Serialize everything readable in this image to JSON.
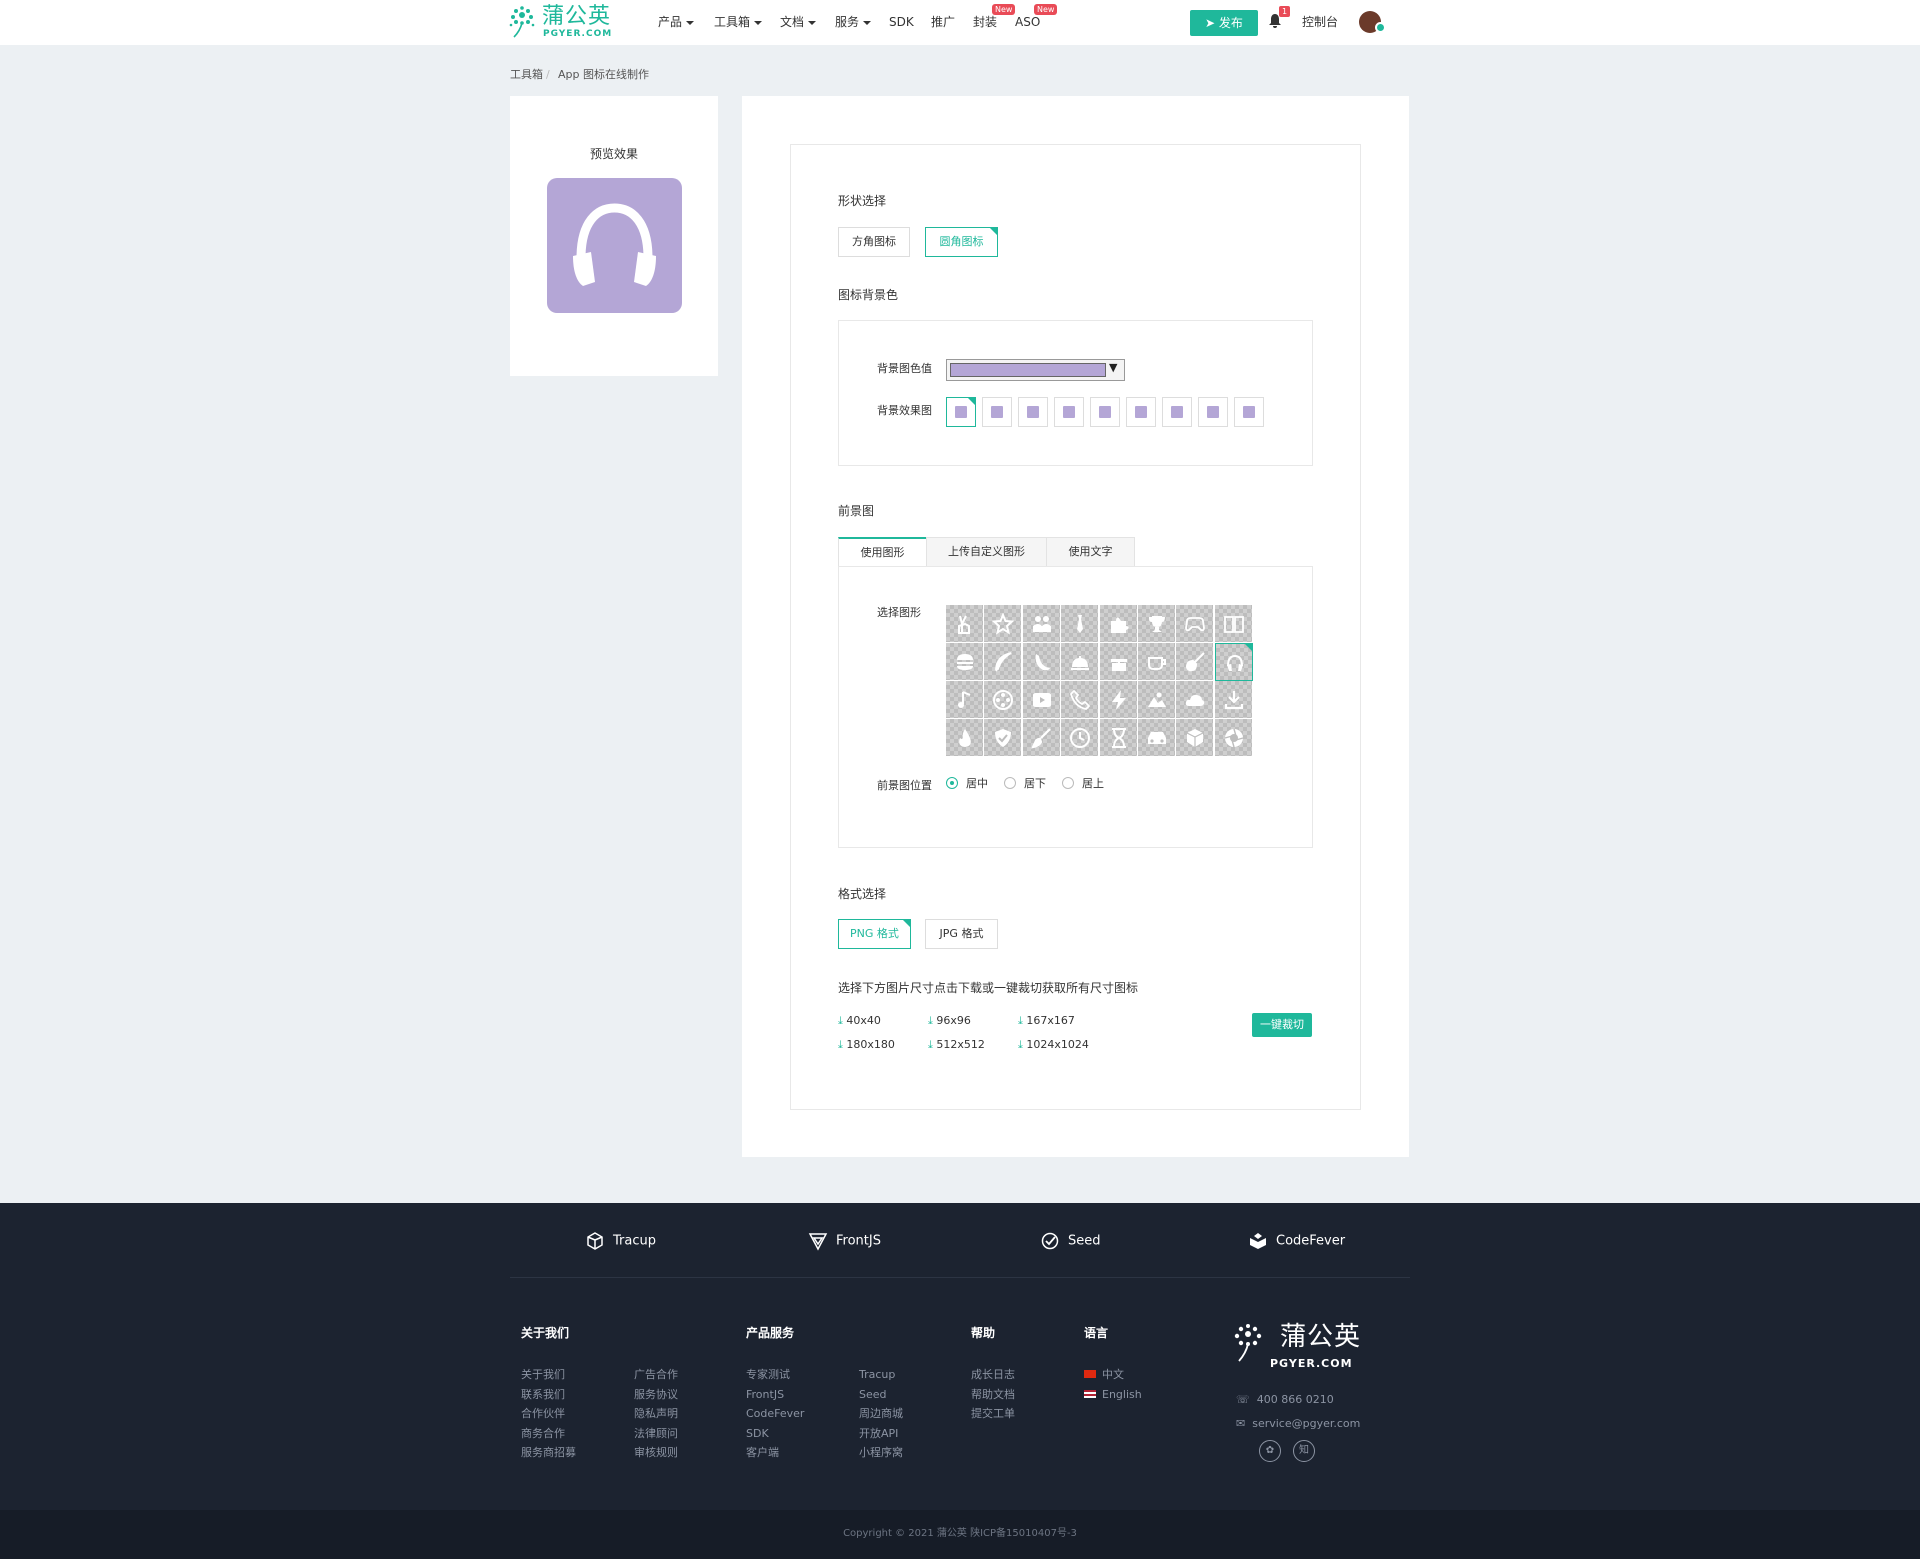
{
  "header": {
    "logo_cn": "蒲公英",
    "logo_en": "PGYER.COM",
    "nav": [
      "产品",
      "工具箱",
      "文档",
      "服务",
      "SDK",
      "推广",
      "封装",
      "ASO"
    ],
    "new_badge": "New",
    "publish": "发布",
    "notif_count": "1",
    "console": "控制台"
  },
  "breadcrumb": [
    "工具箱",
    "App 图标在线制作"
  ],
  "preview": {
    "title": "预览效果",
    "bg_color": "#b4a6d6",
    "icon": "headphones-icon"
  },
  "shape": {
    "label": "形状选择",
    "options": [
      "方角图标",
      "圆角图标"
    ],
    "selected": "圆角图标"
  },
  "bg": {
    "label": "图标背景色",
    "color_label": "背景图色值",
    "color_value": "#b4a6d6",
    "effect_label": "背景效果图",
    "effect_count": 9
  },
  "fg": {
    "label": "前景图",
    "tabs": [
      "使用图形",
      "上传自定义图形",
      "使用文字"
    ],
    "active_tab": "使用图形",
    "shape_label": "选择图形",
    "icons": [
      "peace-icon",
      "star-icon",
      "people-icon",
      "tie-icon",
      "puzzle-icon",
      "trophy-icon",
      "gamepad-icon",
      "book-icon",
      "burger-icon",
      "feather-icon",
      "banana-icon",
      "cloche-icon",
      "gift-icon",
      "coffee-icon",
      "guitar-icon",
      "headphones-icon",
      "music-icon",
      "film-reel-icon",
      "youtube-icon",
      "phone-icon",
      "bolt-icon",
      "sunrise-icon",
      "cloud-icon",
      "download-icon",
      "fire-icon",
      "shield-icon",
      "brush-icon",
      "clock-icon",
      "hourglass-icon",
      "car-icon",
      "cube-icon",
      "aperture-icon"
    ],
    "selected_icon": "headphones-icon",
    "position_label": "前景图位置",
    "positions": [
      "居中",
      "居下",
      "居上"
    ],
    "selected_position": "居中"
  },
  "format": {
    "label": "格式选择",
    "options": [
      "PNG 格式",
      "JPG 格式"
    ],
    "selected": "PNG 格式"
  },
  "download": {
    "hint": "选择下方图片尺寸点击下载或一键裁切获取所有尺寸图标",
    "sizes": [
      "40x40",
      "96x96",
      "167x167",
      "180x180",
      "512x512",
      "1024x1024"
    ],
    "crop": "一键裁切"
  },
  "footer": {
    "products": [
      "Tracup",
      "FrontJS",
      "Seed",
      "CodeFever"
    ],
    "about_title": "关于我们",
    "about": [
      "关于我们",
      "联系我们",
      "合作伙伴",
      "商务合作",
      "服务商招募",
      "广告合作",
      "服务协议",
      "隐私声明",
      "法律顾问",
      "审核规则"
    ],
    "services_title": "产品服务",
    "services": [
      "专家测试",
      "FrontJS",
      "CodeFever",
      "SDK",
      "客户端",
      "Tracup",
      "Seed",
      "周边商城",
      "开放API",
      "小程序窝"
    ],
    "help_title": "帮助",
    "help": [
      "成长日志",
      "帮助文档",
      "提交工单"
    ],
    "lang_title": "语言",
    "langs": [
      "中文",
      "English"
    ],
    "logo_cn": "蒲公英",
    "logo_en": "PGYER.COM",
    "phone": "400 866 0210",
    "email": "service@pgyer.com",
    "social": [
      "wechat-icon",
      "知"
    ],
    "copyright": "Copyright © 2021 蒲公英 陕ICP备15010407号-3"
  },
  "colors": {
    "accent": "#1fb89b",
    "icon_bg": "#b4a6d6",
    "footer_bg": "#1c2330"
  }
}
